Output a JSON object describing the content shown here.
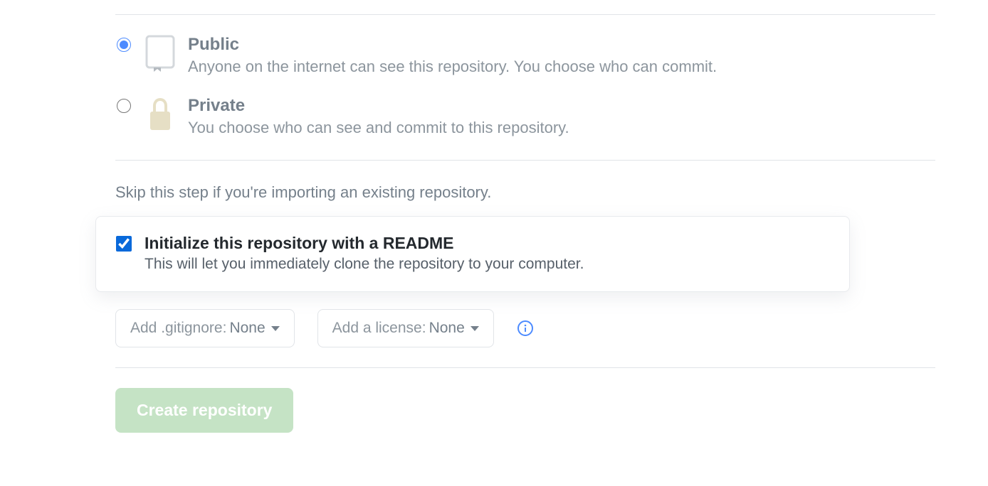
{
  "visibility": {
    "public": {
      "title": "Public",
      "description": "Anyone on the internet can see this repository. You choose who can commit."
    },
    "private": {
      "title": "Private",
      "description": "You choose who can see and commit to this repository."
    }
  },
  "import_hint": "Skip this step if you're importing an existing repository.",
  "readme": {
    "title": "Initialize this repository with a README",
    "description": "This will let you immediately clone the repository to your computer."
  },
  "dropdowns": {
    "gitignore": {
      "label": "Add .gitignore: ",
      "value": "None"
    },
    "license": {
      "label": "Add a license: ",
      "value": "None"
    }
  },
  "submit": {
    "label": "Create repository"
  }
}
